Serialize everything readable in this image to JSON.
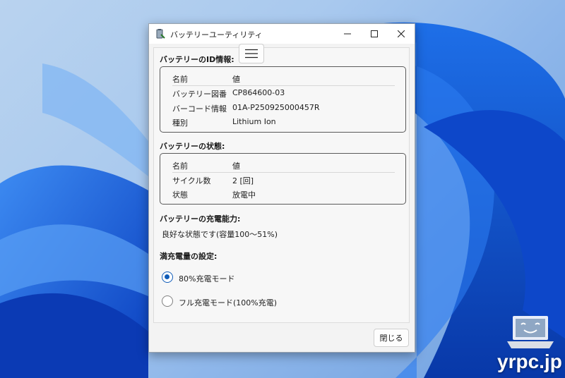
{
  "window": {
    "title": "バッテリーユーティリティ",
    "controls": {
      "minimize": "minimize-icon",
      "maximize": "maximize-icon",
      "close": "close-icon"
    }
  },
  "menu": {
    "icon": "hamburger-menu-icon"
  },
  "id_section": {
    "heading": "バッテリーのID情報:",
    "columns": [
      "名前",
      "値"
    ],
    "rows": [
      [
        "バッテリー図番",
        "CP864600-03"
      ],
      [
        "バーコード情報",
        "01A-P250925000457R"
      ],
      [
        "種別",
        "Lithium Ion"
      ]
    ]
  },
  "status_section": {
    "heading": "バッテリーの状態:",
    "columns": [
      "名前",
      "値"
    ],
    "rows": [
      [
        "サイクル数",
        "2 [回]"
      ],
      [
        "状態",
        "放電中"
      ]
    ]
  },
  "capacity_section": {
    "heading": "バッテリーの充電能力:",
    "text": "良好な状態です(容量100〜51%)"
  },
  "charge_setting": {
    "heading": "満充電量の設定:",
    "options": [
      {
        "label": "80%充電モード",
        "selected": true
      },
      {
        "label": "フル充電モード(100%充電)",
        "selected": false
      }
    ]
  },
  "footer": {
    "close_label": "閉じる"
  },
  "watermark": {
    "text": "yrpc.jp"
  },
  "colors": {
    "accent": "#0f5cb8",
    "wallpaper": "#1a5fd6"
  }
}
